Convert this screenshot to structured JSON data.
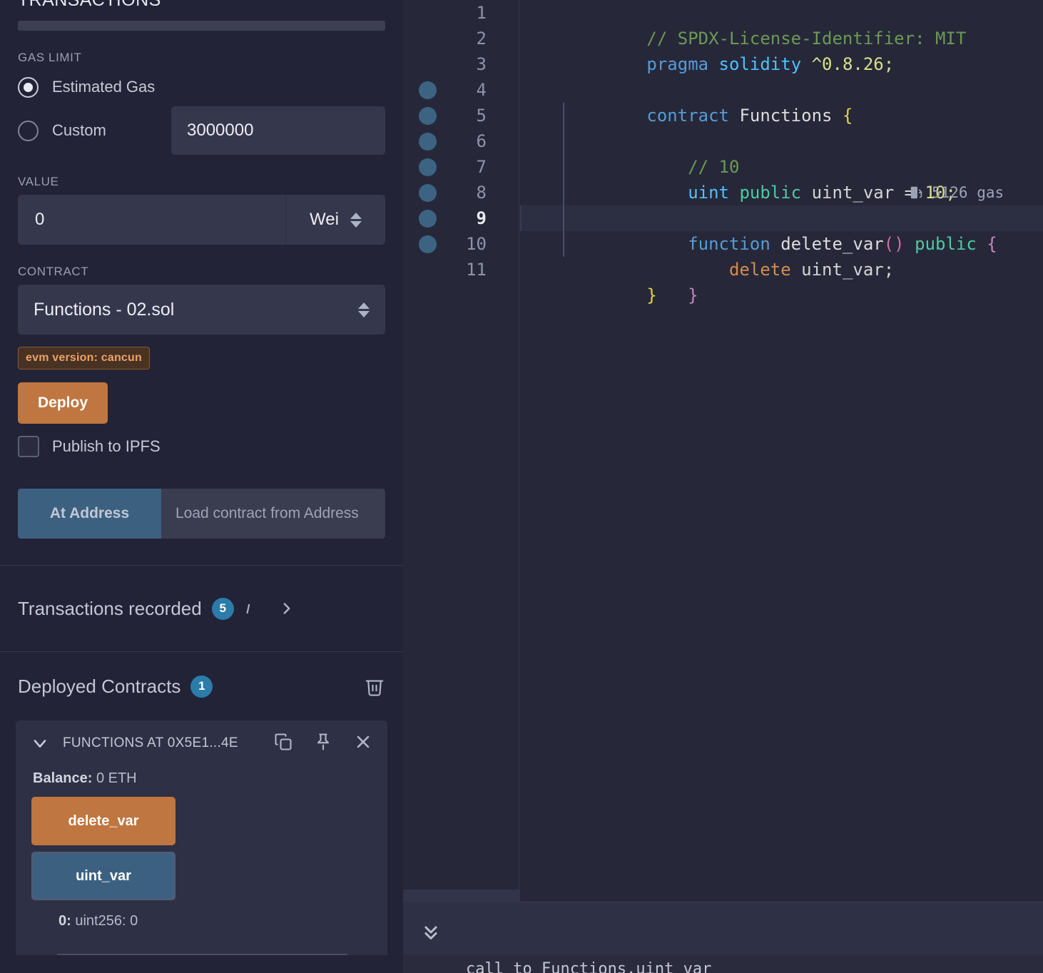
{
  "sidebar": {
    "panel_title": "TRANSACTIONS",
    "gas_limit": {
      "label": "GAS LIMIT",
      "estimated_label": "Estimated Gas",
      "custom_label": "Custom",
      "custom_value": "3000000",
      "selected": "Estimated Gas"
    },
    "value": {
      "label": "VALUE",
      "amount": "0",
      "unit": "Wei"
    },
    "contract": {
      "label": "CONTRACT",
      "selected": "Functions - 02.sol",
      "evm_badge": "evm version: cancun",
      "deploy_label": "Deploy",
      "publish_ipfs_label": "Publish to IPFS",
      "at_address_label": "At Address",
      "at_address_placeholder": "Load contract from Address"
    },
    "transactions_recorded": {
      "label": "Transactions recorded",
      "count": "5",
      "info_icon": "info-icon",
      "chevron_icon": "chevron-right-icon"
    },
    "deployed_contracts": {
      "label": "Deployed Contracts",
      "count": "1",
      "trash_icon": "trash-icon",
      "card": {
        "collapse_icon": "chevron-down-icon",
        "title": "FUNCTIONS AT 0X5E1...4E",
        "copy_icon": "copy-icon",
        "pin_icon": "pin-icon",
        "close_icon": "close-icon",
        "balance_label": "Balance:",
        "balance_value": "0 ETH",
        "functions": [
          {
            "name": "delete_var",
            "kind": "transact"
          },
          {
            "name": "uint_var",
            "kind": "call"
          }
        ],
        "call_result": {
          "index": "0:",
          "value": "uint256: 0"
        }
      }
    }
  },
  "editor": {
    "lines": [
      {
        "n": "1",
        "dot": false,
        "active": false
      },
      {
        "n": "2",
        "dot": false,
        "active": false
      },
      {
        "n": "3",
        "dot": false,
        "active": false
      },
      {
        "n": "4",
        "dot": true,
        "active": false
      },
      {
        "n": "5",
        "dot": true,
        "active": false
      },
      {
        "n": "6",
        "dot": true,
        "active": false
      },
      {
        "n": "7",
        "dot": true,
        "active": false
      },
      {
        "n": "8",
        "dot": true,
        "active": false
      },
      {
        "n": "9",
        "dot": true,
        "active": true
      },
      {
        "n": "10",
        "dot": true,
        "active": false
      },
      {
        "n": "11",
        "dot": false,
        "active": false
      }
    ],
    "code": {
      "l1_comment": "// SPDX-License-Identifier: MIT",
      "l2_pragma": "pragma",
      "l2_solidity": "solidity",
      "l2_version": "^0.8.26;",
      "l4_contract": "contract",
      "l4_name": "Functions",
      "l4_brace": "{",
      "l5_comment": "// 10",
      "l6_uint": "uint",
      "l6_public": "public",
      "l6_var": "uint_var",
      "l6_eq": "=",
      "l6_val": "10;",
      "l8_function": "function",
      "l8_name": "delete_var",
      "l8_parens": "()",
      "l8_public": "public",
      "l8_brace": "{",
      "l9_delete": "delete",
      "l9_var": "uint_var;",
      "l10_brace": "}",
      "l11_brace": "}"
    },
    "gas_annotation": {
      "icon": "gas-pump-icon",
      "text": "5126 gas"
    }
  },
  "terminal": {
    "collapse_icon": "chevrons-down-icon",
    "last_log": "call to Functions.uint_var"
  },
  "colors": {
    "accent_orange": "#c07640",
    "accent_blue": "#3c6180",
    "badge_blue": "#2b7ca8",
    "panel_bg": "#222336",
    "editor_bg": "#262839"
  }
}
